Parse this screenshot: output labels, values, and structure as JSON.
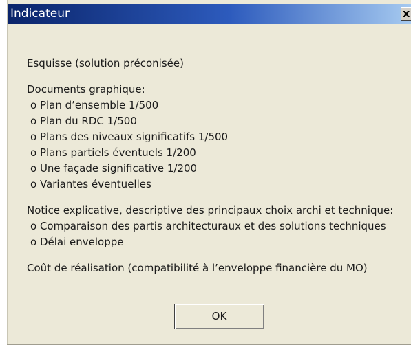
{
  "window": {
    "title": "Indicateur",
    "close_glyph": "x",
    "close_icon": "close-icon"
  },
  "content": {
    "heading": "Esquisse (solution préconisée)",
    "documents": {
      "label": "Documents graphique:",
      "items": [
        "o Plan d’ensemble 1/500",
        "o Plan du RDC 1/500",
        "o Plans des niveaux significatifs 1/500",
        "o Plans partiels éventuels 1/200",
        "o Une façade significative 1/200",
        "o Variantes éventuelles"
      ]
    },
    "notice": {
      "label": "Notice explicative, descriptive des principaux choix archi et technique:",
      "items": [
        "o Comparaison des partis architecturaux et des solutions techniques",
        "o Délai enveloppe"
      ]
    },
    "cost": "Coût de réalisation (compatibilité à l’enveloppe financière du MO)"
  },
  "buttons": {
    "ok_label": "OK"
  },
  "colors": {
    "titlebar_start": "#0a246a",
    "titlebar_end": "#a6caf0",
    "dialog_bg": "#ece9d8"
  }
}
